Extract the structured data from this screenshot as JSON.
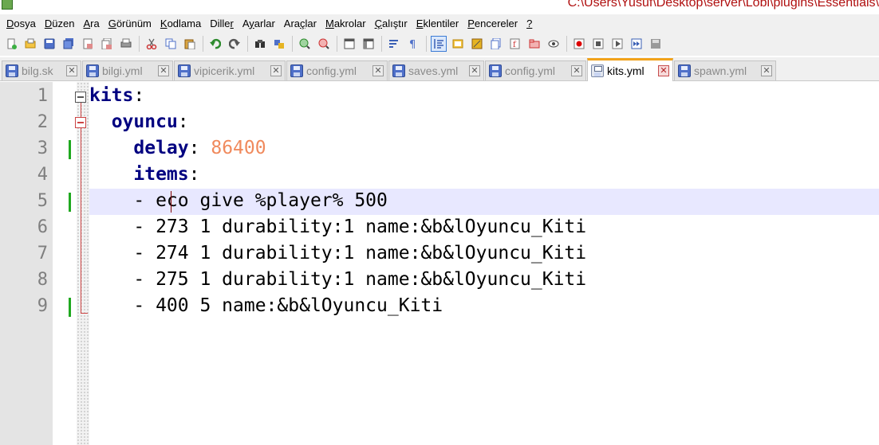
{
  "window": {
    "title": "C:\\Users\\Yusuf\\Desktop\\server\\Lobi\\plugins\\Essentials\\"
  },
  "menu": [
    {
      "mn": "D",
      "rest": "osya"
    },
    {
      "pre": "",
      "mn": "D",
      "rest": "üzen"
    },
    {
      "mn": "A",
      "rest": "ra"
    },
    {
      "mn": "G",
      "rest": "örünüm"
    },
    {
      "mn": "K",
      "rest": "odlama"
    },
    {
      "pre": "Dille",
      "mn": "r",
      "rest": ""
    },
    {
      "pre": "A",
      "mn": "y",
      "rest": "arlar"
    },
    {
      "pre": "Ara",
      "mn": "ç",
      "rest": "lar"
    },
    {
      "mn": "M",
      "rest": "akrolar"
    },
    {
      "mn": "Ç",
      "rest": "alıştır"
    },
    {
      "mn": "E",
      "rest": "klentiler"
    },
    {
      "mn": "P",
      "rest": "encereler"
    },
    {
      "mn": "?",
      "rest": ""
    }
  ],
  "toolbar_icons": [
    "new-file-icon",
    "open-file-icon",
    "save-icon",
    "save-all-icon",
    "close-icon",
    "close-all-icon",
    "print-icon",
    "sep",
    "cut-icon",
    "copy-icon",
    "paste-icon",
    "sep",
    "undo-icon",
    "redo-icon",
    "sep",
    "find-icon",
    "replace-icon",
    "sep",
    "zoom-in-icon",
    "zoom-out-icon",
    "sep",
    "sync-vertical-icon",
    "sync-horizontal-icon",
    "sep",
    "word-wrap-icon",
    "show-all-chars-icon",
    "sep",
    "indent-guide-icon",
    "user-language-icon",
    "map-icon",
    "doc-list-icon",
    "function-list-icon",
    "folder-workspace-icon",
    "monitor-icon",
    "sep",
    "record-macro-icon",
    "stop-macro-icon",
    "play-macro-icon",
    "run-macro-multiple-icon",
    "save-macro-icon"
  ],
  "tabs": [
    {
      "label": "bilg.sk",
      "active": false
    },
    {
      "label": "bilgi.yml",
      "active": false
    },
    {
      "label": "vipicerik.yml",
      "active": false
    },
    {
      "label": "config.yml",
      "active": false
    },
    {
      "label": "saves.yml",
      "active": false
    },
    {
      "label": "config.yml",
      "active": false
    },
    {
      "label": "kits.yml",
      "active": true
    },
    {
      "label": "spawn.yml",
      "active": false
    }
  ],
  "tab_close_glyph": "✕",
  "editor": {
    "current_line": 5,
    "lines": [
      {
        "n": "1",
        "text": "",
        "key": "kits",
        "after": ":",
        "changed": false
      },
      {
        "n": "2",
        "text": "  ",
        "key": "oyuncu",
        "after": ":",
        "changed": false
      },
      {
        "n": "3",
        "text": "    ",
        "key": "delay",
        "after": ": ",
        "num": "86400",
        "changed": true
      },
      {
        "n": "4",
        "text": "    ",
        "key": "items",
        "after": ":",
        "changed": false
      },
      {
        "n": "5",
        "text": "    - eco give %player% 500",
        "changed": true
      },
      {
        "n": "6",
        "text": "    - 273 1 durability:1 name:&b&lOyuncu_Kiti",
        "changed": false
      },
      {
        "n": "7",
        "text": "    - 274 1 durability:1 name:&b&lOyuncu_Kiti",
        "changed": false
      },
      {
        "n": "8",
        "text": "    - 275 1 durability:1 name:&b&lOyuncu_Kiti",
        "changed": false
      },
      {
        "n": "9",
        "text": "    - 400 5 name:&b&lOyuncu_Kiti",
        "changed": true
      }
    ]
  },
  "colors": {
    "key": "#000080",
    "number": "#f08a5d",
    "line_highlight": "#e8e8ff",
    "change_marker": "#1fa81f",
    "active_tab_accent": "#f2a21a"
  }
}
